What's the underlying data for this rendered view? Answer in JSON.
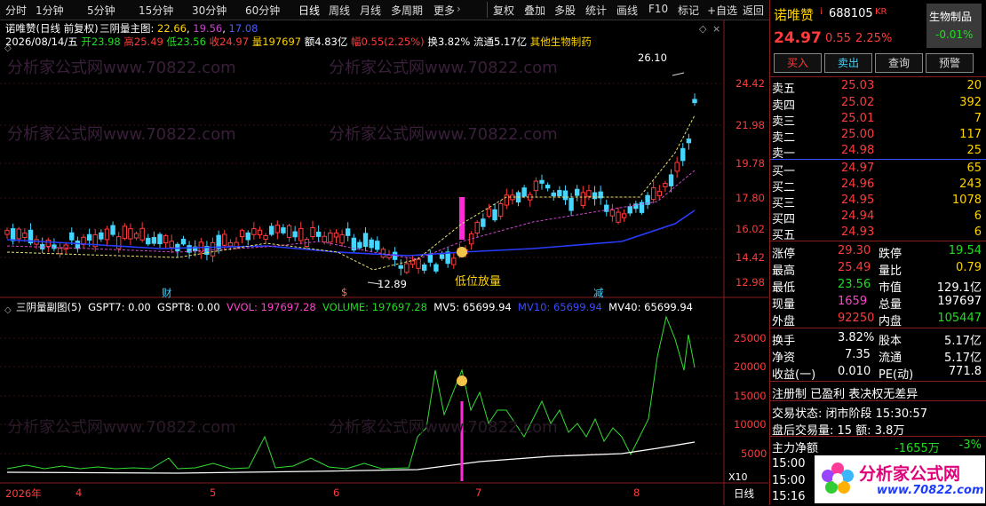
{
  "toolbar": {
    "periods": [
      "分时",
      "1分钟",
      "5分钟",
      "15分钟",
      "30分钟",
      "60分钟",
      "日线",
      "周线",
      "月线",
      "多周期",
      "更多"
    ],
    "tools": [
      "复权",
      "叠加",
      "多股",
      "统计",
      "画线",
      "F10",
      "标记",
      "+自选",
      "返回"
    ]
  },
  "chart": {
    "stock_title": "诺唯赞(日线 前复权)",
    "date_info": "2026/08/14/五",
    "ohlc": {
      "open_label": "开",
      "open": "23.98",
      "high_label": "高",
      "high": "25.49",
      "low_label": "低",
      "low": "23.56",
      "close_label": "收",
      "close": "24.97",
      "vol_label": "量",
      "vol": "197697",
      "amt_label": "额",
      "amt": "4.83亿",
      "amp_label": "幅",
      "amp": "0.55(2.25%)",
      "turn_label": "换",
      "turn": "3.82%",
      "float_label": "流通",
      "float": "5.17亿",
      "sector": "其他生物制药"
    },
    "main_indicator": {
      "name": "三阴量主图",
      "v1": "22.66",
      "v2": "19.56",
      "v3": "17.08"
    },
    "price_axis": [
      "24.42",
      "21.98",
      "19.78",
      "17.80",
      "16.02",
      "14.42",
      "12.98"
    ],
    "high_marker": "26.10",
    "low_marker": "12.89",
    "signal_label": "低位放量",
    "event_markers": [
      "财",
      "$",
      "减"
    ],
    "sub_indicator": {
      "name": "三阴量副图(5)",
      "gspt7": "GSPT7: 0.00",
      "gspt8": "GSPT8: 0.00",
      "vvol": "VVOL: 197697.28",
      "volume": "VOLUME: 197697.28",
      "mv5": "MV5: 65699.94",
      "mv10": "MV10: 65699.94",
      "mv40": "MV40: 65699.94"
    },
    "volume_axis": [
      "25000",
      "20000",
      "15000",
      "10000",
      "5000"
    ],
    "volume_unit": "X10",
    "date_axis": [
      "2026年",
      "4",
      "5",
      "6",
      "7",
      "8"
    ],
    "period_label": "日线",
    "watermark": "分析家公式网www.70822.com"
  },
  "quote": {
    "name": "诺唯赞",
    "code": "688105",
    "badge": "KR",
    "sector": "生物制品",
    "sector_change": "-0.01%",
    "price": "24.97",
    "change": "0.55",
    "change_pct": "2.25%",
    "buttons": [
      "买入",
      "卖出",
      "查询",
      "预警"
    ],
    "asks": [
      {
        "label": "卖五",
        "price": "25.03",
        "vol": "20"
      },
      {
        "label": "卖四",
        "price": "25.02",
        "vol": "392"
      },
      {
        "label": "卖三",
        "price": "25.01",
        "vol": "7"
      },
      {
        "label": "卖二",
        "price": "25.00",
        "vol": "117"
      },
      {
        "label": "卖一",
        "price": "24.98",
        "vol": "25"
      }
    ],
    "bids": [
      {
        "label": "买一",
        "price": "24.97",
        "vol": "65"
      },
      {
        "label": "买二",
        "price": "24.96",
        "vol": "243"
      },
      {
        "label": "买三",
        "price": "24.95",
        "vol": "1078"
      },
      {
        "label": "买四",
        "price": "24.94",
        "vol": "6"
      },
      {
        "label": "买五",
        "price": "24.93",
        "vol": "6"
      }
    ],
    "stats": [
      {
        "l1": "涨停",
        "v1": "29.30",
        "l2": "跌停",
        "v2": "19.54"
      },
      {
        "l1": "最高",
        "v1": "25.49",
        "l2": "量比",
        "v2": "0.79"
      },
      {
        "l1": "最低",
        "v1": "23.56",
        "l2": "市值",
        "v2": "129.1亿"
      },
      {
        "l1": "现量",
        "v1": "1659",
        "l2": "总量",
        "v2": "197697"
      },
      {
        "l1": "外盘",
        "v1": "92250",
        "l2": "内盘",
        "v2": "105447"
      }
    ],
    "stats2": [
      {
        "l1": "换手",
        "v1": "3.82%",
        "l2": "股本",
        "v2": "5.17亿"
      },
      {
        "l1": "净资",
        "v1": "7.35",
        "l2": "流通",
        "v2": "5.17亿"
      },
      {
        "l1": "收益(一)",
        "v1": "0.010",
        "l2": "PE(动)",
        "v2": "771.8"
      }
    ],
    "reg_line": "注册制 已盈利 表决权无差异",
    "trade_status": "交易状态: 闭市阶段 15:30:57",
    "after_hours": "盘后交易量: 15  额: 3.8万",
    "net_flow_label": "主力净额",
    "net_flow": "-1655万",
    "net_flow_pct": "-3%",
    "ticks": [
      "15:00",
      "15:00",
      "15:16"
    ],
    "logo_text": "分析家公式网",
    "logo_url": "www.70822.com"
  }
}
